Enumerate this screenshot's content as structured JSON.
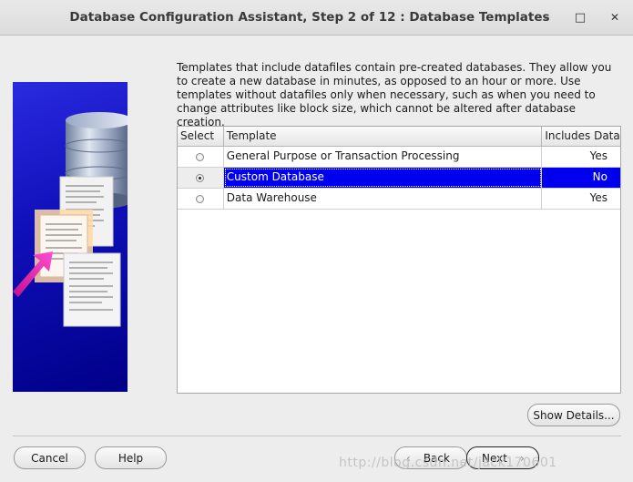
{
  "window": {
    "title": "Database Configuration Assistant, Step 2 of 12 : Database Templates",
    "minimize_glyph": "–",
    "maximize_glyph": "□",
    "close_glyph": "✕"
  },
  "description": "Templates that include datafiles contain pre-created databases. They allow you to create a new database in minutes, as opposed to an hour or more. Use templates without datafiles only when necessary, such as when you need to change attributes like block size, which cannot be altered after database creation.",
  "table": {
    "headers": [
      "Select",
      "Template",
      "Includes Datafiles"
    ],
    "rows": [
      {
        "template": "General Purpose or Transaction Processing",
        "includes": "Yes",
        "selected": false
      },
      {
        "template": "Custom Database",
        "includes": "No",
        "selected": true
      },
      {
        "template": "Data Warehouse",
        "includes": "Yes",
        "selected": false
      }
    ]
  },
  "buttons": {
    "show_details": "Show Details...",
    "cancel": "Cancel",
    "help": "Help",
    "back": "Back",
    "next": "Next"
  },
  "watermark": "http://blog.csdn.net/jack170601"
}
